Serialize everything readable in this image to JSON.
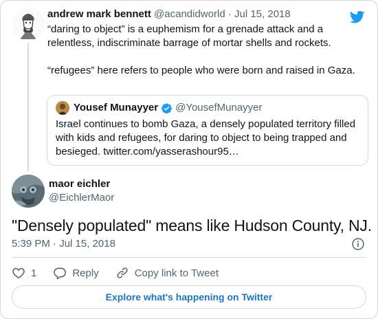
{
  "parent_tweet": {
    "author_name": "andrew mark bennett",
    "meta": "@acandidworld · Jul 15, 2018",
    "paragraphs": [
      "“daring to object” is a euphemism for a grenade attack and a relentless, indiscriminate barrage of mortar shells and rockets.",
      "“refugees” here refers to people who were born and raised in Gaza."
    ]
  },
  "quoted_tweet": {
    "author_name": "Yousef Munayyer",
    "handle": "@YousefMunayyer",
    "text": "Israel continues to bomb Gaza, a densely populated territory filled with kids and refugees, for daring to object to being trapped and besieged. twitter.com/yasserashour95…"
  },
  "main_tweet": {
    "author_name": "maor eichler",
    "handle": "@EichlerMaor",
    "text": "\"Densely populated\" means like Hudson County, NJ.",
    "timestamp": "5:39 PM · Jul 15, 2018"
  },
  "actions": {
    "like_count": "1",
    "reply_label": "Reply",
    "copy_label": "Copy link to Tweet"
  },
  "explore_label": "Explore what's happening on Twitter",
  "colors": {
    "brand_blue": "#1d9bf0",
    "link_blue": "#1d75bf",
    "secondary_text": "#536471",
    "border": "#cfd9de"
  }
}
